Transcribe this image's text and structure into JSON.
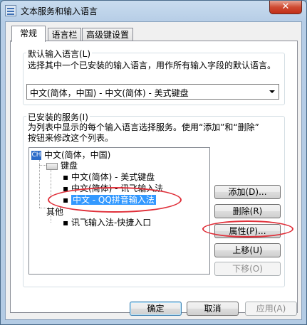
{
  "window": {
    "title": "文本服务和输入语言",
    "close_label": "✕"
  },
  "tabs": [
    {
      "label": "常规",
      "active": true
    },
    {
      "label": "语言栏",
      "active": false
    },
    {
      "label": "高级键设置",
      "active": false
    }
  ],
  "default_lang": {
    "legend": "默认输入语言(L)",
    "description": "选择其中一个已安装的输入语言，用作所有输入字段的默认语言。",
    "selected": "中文(简体，中国) - 中文(简体) - 美式键盘"
  },
  "installed": {
    "legend": "已安装的服务(I)",
    "description_line1": "为列表中显示的每个输入语言选择服务。使用“添加”和“删除”",
    "description_line2": "按钮来修改这个列表。",
    "tree": {
      "root": {
        "code": "CH",
        "label": "中文(简体，中国)"
      },
      "keyboard": "键盘",
      "keyboard_items": [
        "中文(简体) - 美式键盘",
        "中文(简体) - 讯飞输入法",
        "中文 - QQ拼音输入法"
      ],
      "other": "其他",
      "other_items": [
        "讯飞输入法-快捷入口"
      ]
    },
    "buttons": {
      "add": "添加(D)...",
      "remove": "删除(R)",
      "properties": "属性(P)...",
      "move_up": "上移(U)",
      "move_down": "下移(O)"
    }
  },
  "footer": {
    "ok": "确定",
    "cancel": "取消",
    "apply": "应用(A)"
  },
  "colors": {
    "selection": "#3399ff",
    "annotation": "#e0303a"
  }
}
